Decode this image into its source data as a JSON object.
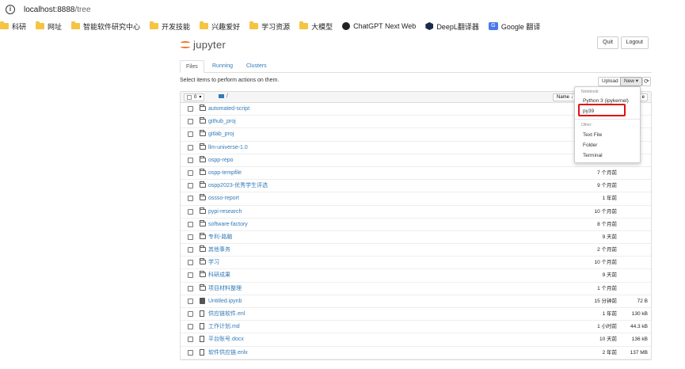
{
  "browser": {
    "url_host": "localhost:8888",
    "url_path": "/tree"
  },
  "bookmarks": [
    {
      "label": "科研",
      "icon": "folder-icon"
    },
    {
      "label": "网址",
      "icon": "folder-icon"
    },
    {
      "label": "智能软件研究中心",
      "icon": "folder-icon"
    },
    {
      "label": "开发技能",
      "icon": "folder-icon"
    },
    {
      "label": "兴趣爱好",
      "icon": "folder-icon"
    },
    {
      "label": "学习资源",
      "icon": "folder-icon"
    },
    {
      "label": "大模型",
      "icon": "folder-icon"
    },
    {
      "label": "ChatGPT Next Web",
      "icon": "chatgpt-icon"
    },
    {
      "label": "DeepL翻译器",
      "icon": "deepl-icon"
    },
    {
      "label": "Google 翻译",
      "icon": "google-translate-icon"
    }
  ],
  "header": {
    "logo_text": "jupyter",
    "quit_label": "Quit",
    "logout_label": "Logout"
  },
  "tabs": [
    {
      "label": "Files",
      "active": true
    },
    {
      "label": "Running",
      "active": false
    },
    {
      "label": "Clusters",
      "active": false
    }
  ],
  "toolbar": {
    "hint": "Select items to perform actions on them.",
    "upload_label": "Upload",
    "new_label": "New ▾",
    "refresh_icon": "⟳"
  },
  "list_header": {
    "selected_count": "0",
    "breadcrumb": "/",
    "name_sort": "Name ↓",
    "right_sort": "e"
  },
  "files": [
    {
      "name": "automated-script",
      "type": "folder",
      "modified": "",
      "size": ""
    },
    {
      "name": "github_proj",
      "type": "folder",
      "modified": "",
      "size": ""
    },
    {
      "name": "gitlab_proj",
      "type": "folder",
      "modified": "",
      "size": ""
    },
    {
      "name": "llm-universe-1.0",
      "type": "folder",
      "modified": "",
      "size": ""
    },
    {
      "name": "ospp-repo",
      "type": "folder",
      "modified": "",
      "size": ""
    },
    {
      "name": "ospp-tempfile",
      "type": "folder",
      "modified": "7 个月前",
      "size": ""
    },
    {
      "name": "ospp2023-优秀学生评选",
      "type": "folder",
      "modified": "9 个月前",
      "size": ""
    },
    {
      "name": "ossso-report",
      "type": "folder",
      "modified": "1 年前",
      "size": ""
    },
    {
      "name": "pypi-research",
      "type": "folder",
      "modified": "10 个月前",
      "size": ""
    },
    {
      "name": "software-factory",
      "type": "folder",
      "modified": "8 个月前",
      "size": ""
    },
    {
      "name": "专利-路脑",
      "type": "folder",
      "modified": "9 天前",
      "size": ""
    },
    {
      "name": "其他事务",
      "type": "folder",
      "modified": "2 个月前",
      "size": ""
    },
    {
      "name": "学习",
      "type": "folder",
      "modified": "10 个月前",
      "size": ""
    },
    {
      "name": "科研成果",
      "type": "folder",
      "modified": "9 天前",
      "size": ""
    },
    {
      "name": "项目材料整理",
      "type": "folder",
      "modified": "1 个月前",
      "size": ""
    },
    {
      "name": "Untitled.ipynb",
      "type": "notebook",
      "modified": "15 分钟前",
      "size": "72 B"
    },
    {
      "name": "供应链软件.enl",
      "type": "file",
      "modified": "1 年前",
      "size": "130 kB"
    },
    {
      "name": "工作计划.md",
      "type": "file",
      "modified": "1 小时前",
      "size": "44.3 kB"
    },
    {
      "name": "平台账号.docx",
      "type": "file",
      "modified": "10 天前",
      "size": "136 kB"
    },
    {
      "name": "软件供应链.enlx",
      "type": "file",
      "modified": "2 年前",
      "size": "137 MB"
    }
  ],
  "new_dropdown": {
    "notebook_header": "Notebook:",
    "notebook_items": [
      "Python 3 (ipykernel)",
      "py39"
    ],
    "other_header": "Other:",
    "other_items": [
      "Text File",
      "Folder",
      "Terminal"
    ],
    "highlighted": "py39",
    "highlight_color": "#e01010"
  },
  "colors": {
    "link": "#337ab7",
    "jupyter_orange": "#f37726"
  }
}
